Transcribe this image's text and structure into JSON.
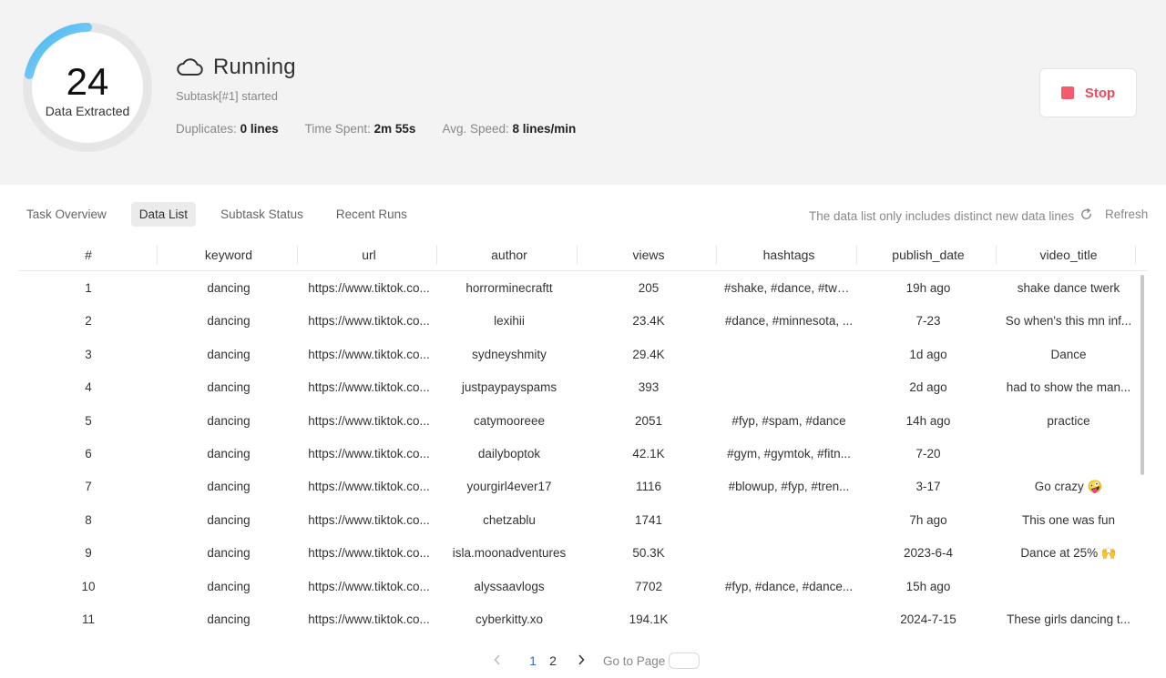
{
  "header": {
    "progress_count": "24",
    "progress_label": "Data Extracted",
    "status": "Running",
    "subtask": "Subtask[#1] started",
    "stats": {
      "duplicates_label": "Duplicates:",
      "duplicates_value": "0 lines",
      "time_label": "Time Spent:",
      "time_value": "2m 55s",
      "speed_label": "Avg. Speed:",
      "speed_value": "8 lines/min"
    },
    "stop_label": "Stop"
  },
  "tabs": [
    {
      "label": "Task Overview",
      "active": false
    },
    {
      "label": "Data List",
      "active": true
    },
    {
      "label": "Subtask Status",
      "active": false
    },
    {
      "label": "Recent Runs",
      "active": false
    }
  ],
  "note": "The data list only includes distinct new data lines",
  "refresh_label": "Refresh",
  "table": {
    "columns": [
      "#",
      "keyword",
      "url",
      "author",
      "views",
      "hashtags",
      "publish_date",
      "video_title"
    ],
    "rows": [
      [
        "1",
        "dancing",
        "https://www.tiktok.co...",
        "horrorminecraftt",
        "205",
        "#shake, #dance, #twe...",
        "19h ago",
        "shake dance twerk"
      ],
      [
        "2",
        "dancing",
        "https://www.tiktok.co...",
        "lexihii",
        "23.4K",
        "#dance, #minnesota, ...",
        "7-23",
        "So when's this mn inf..."
      ],
      [
        "3",
        "dancing",
        "https://www.tiktok.co...",
        "sydneyshmity",
        "29.4K",
        "",
        "1d ago",
        "Dance"
      ],
      [
        "4",
        "dancing",
        "https://www.tiktok.co...",
        "justpaypayspams",
        "393",
        "",
        "2d ago",
        "had to show the man..."
      ],
      [
        "5",
        "dancing",
        "https://www.tiktok.co...",
        "catymooreee",
        "2051",
        "#fyp, #spam, #dance",
        "14h ago",
        "practice"
      ],
      [
        "6",
        "dancing",
        "https://www.tiktok.co...",
        "dailyboptok",
        "42.1K",
        "#gym, #gymtok, #fitn...",
        "7-20",
        ""
      ],
      [
        "7",
        "dancing",
        "https://www.tiktok.co...",
        "yourgirl4ever17",
        "1116",
        "#blowup, #fyp, #tren...",
        "3-17",
        "Go crazy 🤪"
      ],
      [
        "8",
        "dancing",
        "https://www.tiktok.co...",
        "chetzablu",
        "1741",
        "",
        "7h ago",
        "This one was fun"
      ],
      [
        "9",
        "dancing",
        "https://www.tiktok.co...",
        "isla.moonadventures",
        "50.3K",
        "",
        "2023-6-4",
        "Dance at 25% 🙌"
      ],
      [
        "10",
        "dancing",
        "https://www.tiktok.co...",
        "alyssaavlogs",
        "7702",
        "#fyp, #dance, #dance...",
        "15h ago",
        ""
      ],
      [
        "11",
        "dancing",
        "https://www.tiktok.co...",
        "cyberkitty.xo",
        "194.1K",
        "",
        "2024-7-15",
        "These girls dancing t..."
      ]
    ]
  },
  "pagination": {
    "pages": [
      "1",
      "2"
    ],
    "current": "1",
    "prev_icon": "chevron-left-icon",
    "next_icon": "chevron-right-icon",
    "goto_label": "Go to Page"
  },
  "colors": {
    "ring_track": "#e6e6e6",
    "ring_progress": "#3db4ef",
    "stop": "#f45b6c",
    "active_page": "#2d6cdf"
  }
}
